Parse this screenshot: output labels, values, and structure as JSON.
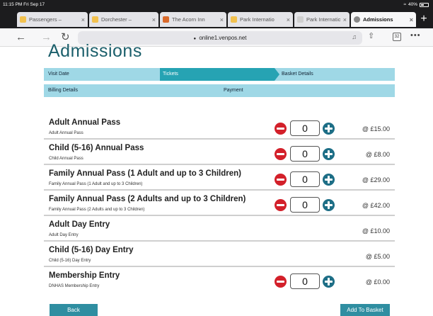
{
  "status_bar": {
    "time": "11:15 PM  Fri Sep 17",
    "battery": "40%"
  },
  "browser": {
    "tabs": [
      {
        "title": "Passengers – ",
        "active": false,
        "favicon_color": "#f2c14e"
      },
      {
        "title": "Dorchester – ",
        "active": false,
        "favicon_color": "#f2c14e"
      },
      {
        "title": "The Acorn Inn",
        "active": false,
        "favicon_color": "#d96a2b"
      },
      {
        "title": "Park Internatio",
        "active": false,
        "favicon_color": "#f2c14e"
      },
      {
        "title": "Park Internatio",
        "active": false,
        "favicon_color": "#cfcfcf"
      },
      {
        "title": "Admissions",
        "active": true,
        "favicon_color": "#888888"
      }
    ],
    "url": "online1.venpos.net"
  },
  "page": {
    "title": "Admissions",
    "steps_row1": {
      "visit_date": "Visit Date",
      "tickets": "Tickets",
      "basket_details": "Basket Details"
    },
    "steps_row2": {
      "billing_details": "Billing Details",
      "payment": "Payment"
    },
    "products": [
      {
        "name": "Adult Annual Pass",
        "desc": "Adult Annual Pass",
        "price": "@ £15.00",
        "qty": "0",
        "has_qty": true
      },
      {
        "name": "Child (5-16) Annual Pass",
        "desc": "Child Annual Pass",
        "price": "@ £8.00",
        "qty": "0",
        "has_qty": true
      },
      {
        "name": "Family Annual Pass (1 Adult and up to 3 Children)",
        "desc": "Family Annual Pass (1 Adult and up to 3 Children)",
        "price": "@ £29.00",
        "qty": "0",
        "has_qty": true
      },
      {
        "name": "Family Annual Pass (2 Adults and up to 3 Children)",
        "desc": "Family Annual Pass (2 Adults and up to 3 Children)",
        "price": "@ £42.00",
        "qty": "0",
        "has_qty": true
      },
      {
        "name": "Adult Day Entry",
        "desc": "Adult Day Entry",
        "price": "@ £10.00",
        "qty": "",
        "has_qty": false
      },
      {
        "name": "Child (5-16) Day Entry",
        "desc": "Child (5-16) Day Entry",
        "price": "@ £5.00",
        "qty": "",
        "has_qty": false
      },
      {
        "name": "Membership Entry",
        "desc": "DNHAS Membership Entry",
        "price": "@ £0.00",
        "qty": "0",
        "has_qty": true
      }
    ],
    "buttons": {
      "back": "Back",
      "add_to_basket": "Add To Basket"
    }
  },
  "colors": {
    "accent": "#26a3b3",
    "steps_bg": "#9fd8e6",
    "title": "#1b5f6b",
    "minus": "#d3202a",
    "plus": "#1d6e86"
  }
}
